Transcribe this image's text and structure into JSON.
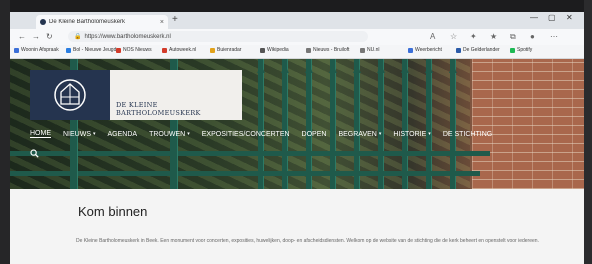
{
  "browser": {
    "tab_title": "De Kleine Bartholomeuskerk",
    "tab_close": "×",
    "new_tab": "+",
    "window_buttons": [
      "—",
      "▢",
      "✕"
    ],
    "url": "https://www.bartholomeuskerk.nl",
    "bookmarks": [
      {
        "label": "Woonin Afspraak",
        "color": "#3b6fd8"
      },
      {
        "label": "Bol - Nieuwe Jeugd",
        "color": "#2a7de1"
      },
      {
        "label": "NOS Nieuws",
        "color": "#d23b2a"
      },
      {
        "label": "Autoweek.nl",
        "color": "#d23b2a"
      },
      {
        "label": "Buienradar",
        "color": "#e2a21b"
      },
      {
        "label": "Wikipedia",
        "color": "#555555"
      },
      {
        "label": "Nieuws - Bruiloft",
        "color": "#777777"
      },
      {
        "label": "NU.nl",
        "color": "#777777"
      },
      {
        "label": "Weerbericht",
        "color": "#3b6fd8"
      },
      {
        "label": "De Gelderlander",
        "color": "#2a5aa8"
      },
      {
        "label": "Spotify",
        "color": "#1db954"
      }
    ]
  },
  "site": {
    "title": "DE KLEINE BARTHOLOMEUSKERK",
    "menu": [
      {
        "label": "HOME",
        "dropdown": false,
        "active": true
      },
      {
        "label": "NIEUWS",
        "dropdown": true,
        "active": false
      },
      {
        "label": "AGENDA",
        "dropdown": false,
        "active": false
      },
      {
        "label": "TROUWEN",
        "dropdown": true,
        "active": false
      },
      {
        "label": "EXPOSITIES/CONCERTEN",
        "dropdown": false,
        "active": false
      },
      {
        "label": "DOPEN",
        "dropdown": false,
        "active": false
      },
      {
        "label": "BEGRAVEN",
        "dropdown": true,
        "active": false
      },
      {
        "label": "HISTORIE",
        "dropdown": true,
        "active": false
      },
      {
        "label": "DE STICHTING",
        "dropdown": false,
        "active": false
      }
    ],
    "heading": "Kom binnen",
    "intro": "De Kleine Bartholomeuskerk in Beek. Een monument voor concerten, exposities, huwelijken, doop- en afscheidsdiensten. Welkom op de website van de stichting die de kerk beheert en openstelt voor iedereen."
  },
  "colors": {
    "brand_navy": "#25344f",
    "gate_green": "#1f5a4b",
    "brick": "#a9674c"
  }
}
